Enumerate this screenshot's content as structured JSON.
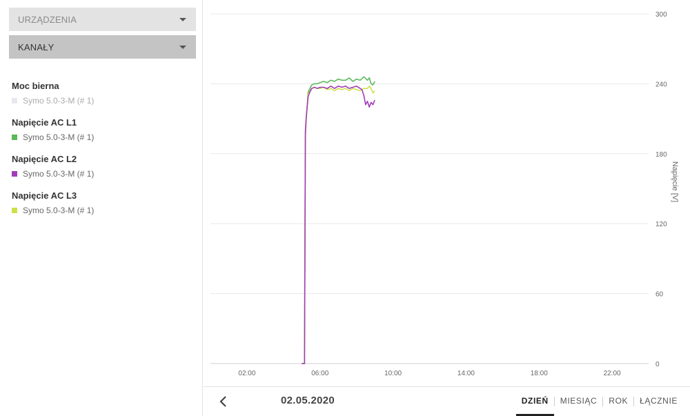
{
  "sidebar": {
    "devices_label": "URZĄDZENIA",
    "channels_label": "KANAŁY",
    "legend": [
      {
        "title": "Moc bierna",
        "entry": "Symo 5.0-3-M (# 1)",
        "color": "#e8e8f2"
      },
      {
        "title": "Napięcie AC L1",
        "entry": "Symo 5.0-3-M (# 1)",
        "color": "#5cb85c"
      },
      {
        "title": "Napięcie AC L2",
        "entry": "Symo 5.0-3-M (# 1)",
        "color": "#a23cb8"
      },
      {
        "title": "Napięcie AC L3",
        "entry": "Symo 5.0-3-M (# 1)",
        "color": "#cde04b"
      }
    ]
  },
  "footer": {
    "date": "02.05.2020",
    "tabs": [
      "DZIEŃ",
      "MIESIĄC",
      "ROK",
      "ŁĄCZNIE"
    ],
    "active_tab": "DZIEŃ"
  },
  "chart_data": {
    "type": "line",
    "ylabel": "Napięcie [V]",
    "ylim": [
      0,
      300
    ],
    "yticks": [
      0,
      60,
      120,
      180,
      240,
      300
    ],
    "xlim": [
      0,
      24
    ],
    "xticks": [
      2,
      6,
      10,
      14,
      18,
      22
    ],
    "xtick_labels": [
      "02:00",
      "06:00",
      "10:00",
      "14:00",
      "18:00",
      "22:00"
    ],
    "grid": true,
    "series": [
      {
        "name": "Napięcie AC L1",
        "color": "#5cb85c",
        "x": [
          5.0,
          5.05,
          5.15,
          5.2,
          5.25,
          5.35,
          5.45,
          5.55,
          5.7,
          5.85,
          6.0,
          6.2,
          6.4,
          6.6,
          6.8,
          7.0,
          7.2,
          7.4,
          7.6,
          7.8,
          8.0,
          8.2,
          8.4,
          8.6,
          8.7,
          8.8,
          8.9,
          9.0
        ],
        "y": [
          0,
          0,
          0,
          195,
          210,
          233,
          236,
          239,
          240,
          240,
          241,
          242,
          241,
          243,
          242,
          244,
          243,
          243,
          245,
          242,
          244,
          243,
          246,
          243,
          245,
          240,
          239,
          242
        ]
      },
      {
        "name": "Napięcie AC L2",
        "color": "#a23cb8",
        "x": [
          5.0,
          5.05,
          5.15,
          5.2,
          5.25,
          5.35,
          5.45,
          5.55,
          5.7,
          5.85,
          6.0,
          6.2,
          6.4,
          6.6,
          6.8,
          7.0,
          7.2,
          7.4,
          7.6,
          7.8,
          8.0,
          8.2,
          8.3,
          8.4,
          8.5,
          8.6,
          8.7,
          8.8,
          8.9,
          9.0
        ],
        "y": [
          0,
          0,
          0,
          200,
          212,
          229,
          233,
          236,
          237,
          236,
          237,
          237,
          236,
          238,
          236,
          238,
          237,
          238,
          236,
          237,
          238,
          236,
          235,
          230,
          222,
          225,
          220,
          224,
          222,
          226
        ]
      },
      {
        "name": "Napięcie AC L3",
        "color": "#cde04b",
        "x": [
          5.0,
          5.05,
          5.15,
          5.2,
          5.25,
          5.35,
          5.45,
          5.55,
          5.7,
          5.85,
          6.0,
          6.2,
          6.4,
          6.6,
          6.8,
          7.0,
          7.2,
          7.4,
          7.6,
          7.8,
          8.0,
          8.2,
          8.4,
          8.6,
          8.7,
          8.8,
          8.9,
          9.0
        ],
        "y": [
          0,
          0,
          0,
          198,
          212,
          231,
          234,
          236,
          237,
          236,
          236,
          237,
          235,
          236,
          234,
          236,
          235,
          236,
          234,
          236,
          235,
          234,
          236,
          236,
          238,
          236,
          232,
          234
        ]
      }
    ]
  }
}
